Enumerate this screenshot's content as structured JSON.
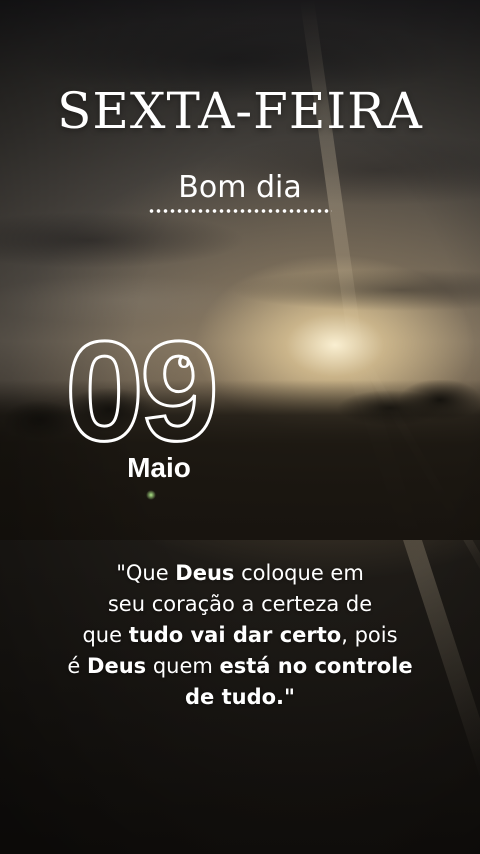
{
  "header": {
    "weekday": "SEXTA-FEIRA",
    "greeting": "Bom dia"
  },
  "date": {
    "day": "09",
    "day_suffix": "o",
    "month": "Maio"
  },
  "quote": {
    "lines": [
      [
        {
          "t": "\"Que ",
          "b": false
        },
        {
          "t": "Deus",
          "b": true
        },
        {
          "t": " coloque em",
          "b": false
        }
      ],
      [
        {
          "t": "seu coração a certeza de",
          "b": false
        }
      ],
      [
        {
          "t": "que ",
          "b": false
        },
        {
          "t": "tudo vai dar certo",
          "b": true
        },
        {
          "t": ", pois",
          "b": false
        }
      ],
      [
        {
          "t": "é ",
          "b": false
        },
        {
          "t": "Deus",
          "b": true
        },
        {
          "t": " quem ",
          "b": false
        },
        {
          "t": "está no controle",
          "b": true
        }
      ],
      [
        {
          "t": "de tudo.\"",
          "b": true
        }
      ]
    ]
  },
  "colors": {
    "text": "#ffffff"
  }
}
